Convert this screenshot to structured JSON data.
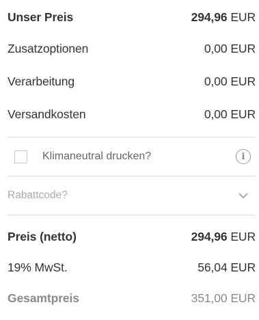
{
  "prices": {
    "unser_preis": {
      "label": "Unser Preis",
      "amount": "294,96",
      "currency": "EUR"
    },
    "zusatzoptionen": {
      "label": "Zusatzoptionen",
      "amount": "0,00",
      "currency": "EUR"
    },
    "verarbeitung": {
      "label": "Verarbeitung",
      "amount": "0,00",
      "currency": "EUR"
    },
    "versandkosten": {
      "label": "Versandkosten",
      "amount": "0,00",
      "currency": "EUR"
    }
  },
  "klimaneutral": {
    "label": "Klimaneutral drucken?",
    "checked": false,
    "info_icon": "info-icon"
  },
  "rabatt": {
    "placeholder": "Rabattcode?",
    "icon": "chevron-down-icon"
  },
  "totals": {
    "netto": {
      "label": "Preis (netto)",
      "amount": "294,96",
      "currency": "EUR"
    },
    "mwst": {
      "label": "19% MwSt.",
      "amount": "56,04",
      "currency": "EUR"
    },
    "gesamt": {
      "label": "Gesamtpreis",
      "amount": "351,00",
      "currency": "EUR"
    }
  },
  "colors": {
    "text": "#333333",
    "muted": "#8a8a8a",
    "placeholder": "#ababab",
    "divider": "#dcdcdc"
  }
}
